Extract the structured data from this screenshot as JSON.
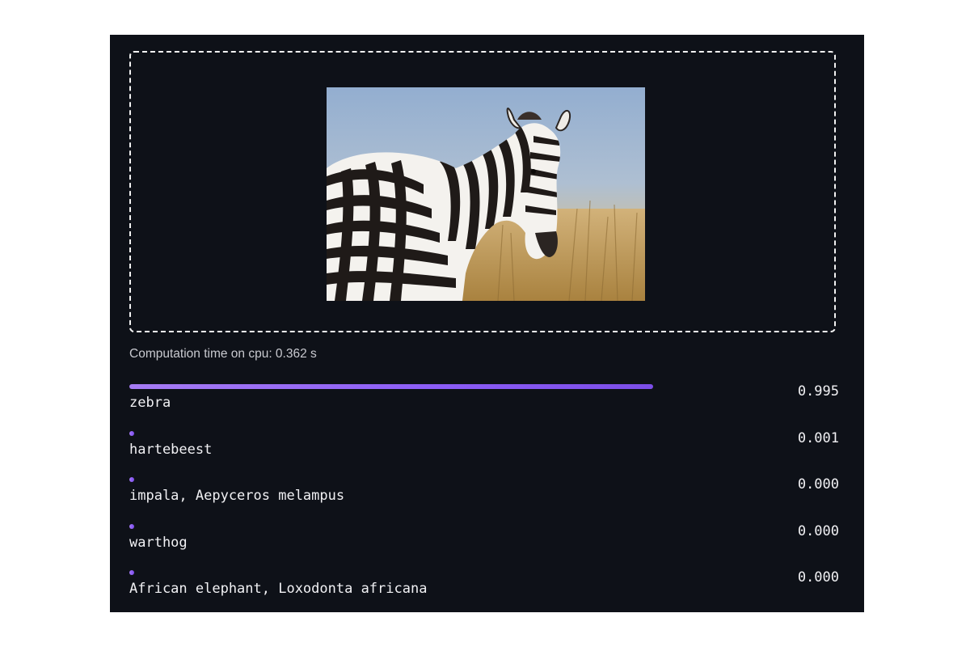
{
  "dropzone": {
    "image": {
      "subject": "zebra standing in dry grass",
      "sky_color": "#9bb2cf",
      "grass_color": "#c8a466"
    }
  },
  "timing_text": "Computation time on cpu: 0.362 s",
  "predictions": [
    {
      "label": "zebra",
      "score_text": "0.995",
      "score": 0.995
    },
    {
      "label": "hartebeest",
      "score_text": "0.001",
      "score": 0.001
    },
    {
      "label": "impala, Aepyceros melampus",
      "score_text": "0.000",
      "score": 0.0
    },
    {
      "label": "warthog",
      "score_text": "0.000",
      "score": 0.0
    },
    {
      "label": "African elephant, Loxodonta africana",
      "score_text": "0.000",
      "score": 0.0
    }
  ],
  "colors": {
    "panel_bg": "#0e1118",
    "bar_accent": "#8b5cf6",
    "text": "#f1f1f4",
    "muted_text": "#c9cad0"
  }
}
